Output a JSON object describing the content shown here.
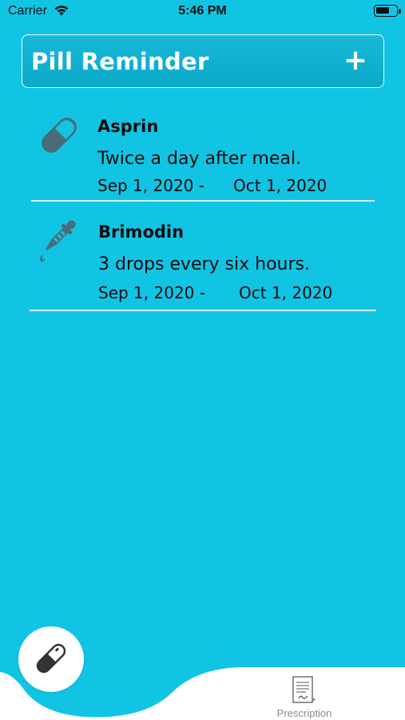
{
  "status_bar": {
    "carrier": "Carrier",
    "time": "5:46 PM",
    "wifi_icon": "wifi-icon",
    "battery_icon": "battery-icon"
  },
  "header": {
    "title": "Pill Reminder",
    "add_label": "+"
  },
  "medications": [
    {
      "icon": "pill-capsule-icon",
      "name": "Asprin",
      "description": "Twice a day after meal.",
      "start": "Sep 1, 2020 -",
      "end": "Oct 1, 2020"
    },
    {
      "icon": "dropper-icon",
      "name": "Brimodin",
      "description": "3 drops every six hours.",
      "start": "Sep 1, 2020 -",
      "end": "Oct 1, 2020"
    }
  ],
  "tab_bar": {
    "fab_icon": "pill-icon",
    "prescription_label": "Prescription",
    "prescription_icon": "document-icon"
  },
  "colors": {
    "background": "#12c4e4",
    "header": "#0aa9c8",
    "icon": "#4a6b78",
    "tab_bar": "#ffffff"
  }
}
